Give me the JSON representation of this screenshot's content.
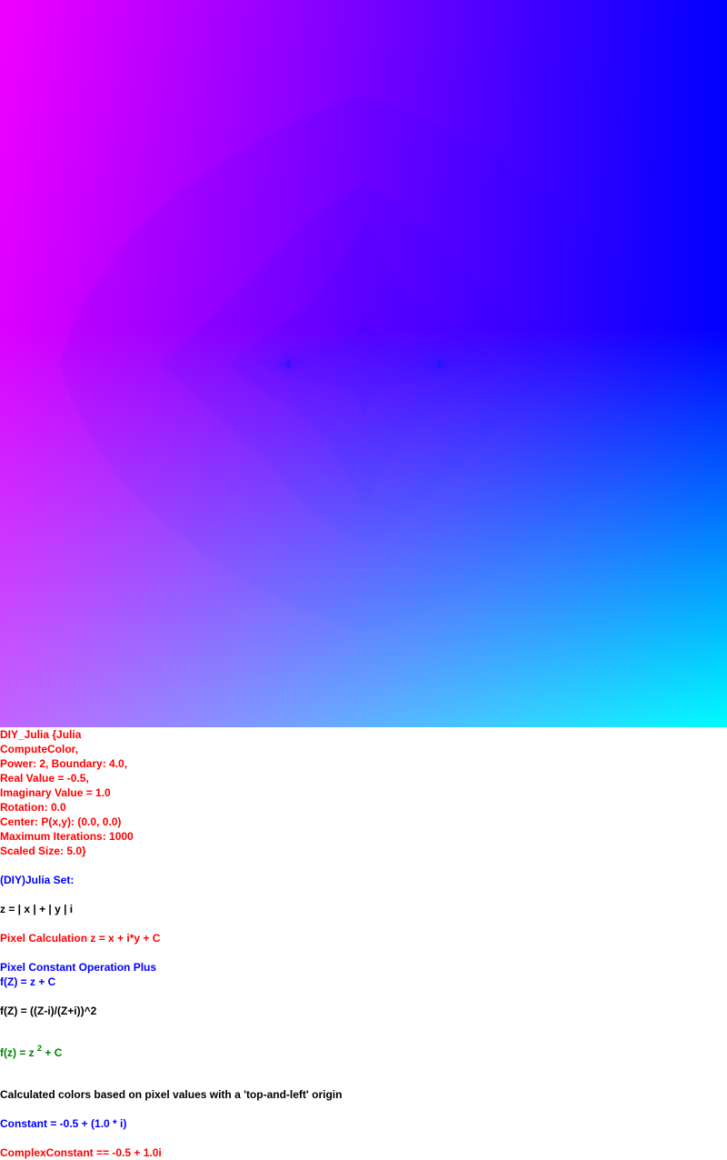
{
  "params": {
    "line1": "DIY_Julia {Julia",
    "line2": "ComputeColor,",
    "line3": "Power: 2, Boundary: 4.0,",
    "line4": "Real Value = -0.5,",
    "line5": "Imaginary Value = 1.0",
    "line6": "Rotation: 0.0",
    "line7": "Center: P(x,y): (0.0, 0.0)",
    "line8": "Maximum Iterations: 1000",
    "line9": "Scaled Size: 5.0}"
  },
  "set_title": "(DIY)Julia Set:",
  "z_def": "z = | x | + | y | i",
  "pixel_calc": "Pixel Calculation z = x + i*y + C",
  "operation": "Pixel Constant Operation Plus",
  "f_plus": "f(Z) = z + C",
  "f_mobius": "f(Z) = ((Z-i)/(Z+i))^2",
  "f_power": {
    "prefix": "f(z) = z",
    "exponent": "2",
    "suffix": " + C"
  },
  "colors_note": "Calculated colors based on pixel values with a 'top-and-left' origin",
  "constant": "Constant = -0.5 + (1.0 * i)",
  "complex_constant": "ComplexConstant == -0.5 + 1.0i",
  "fractal": {
    "real": -0.5,
    "imag": 1.0,
    "power": 2,
    "boundary": 4.0,
    "max_iterations": 1000,
    "scaled_size": 5.0,
    "center_x": 0.0,
    "center_y": 0.0,
    "rotation": 0.0,
    "set_color": "#ffff33"
  }
}
